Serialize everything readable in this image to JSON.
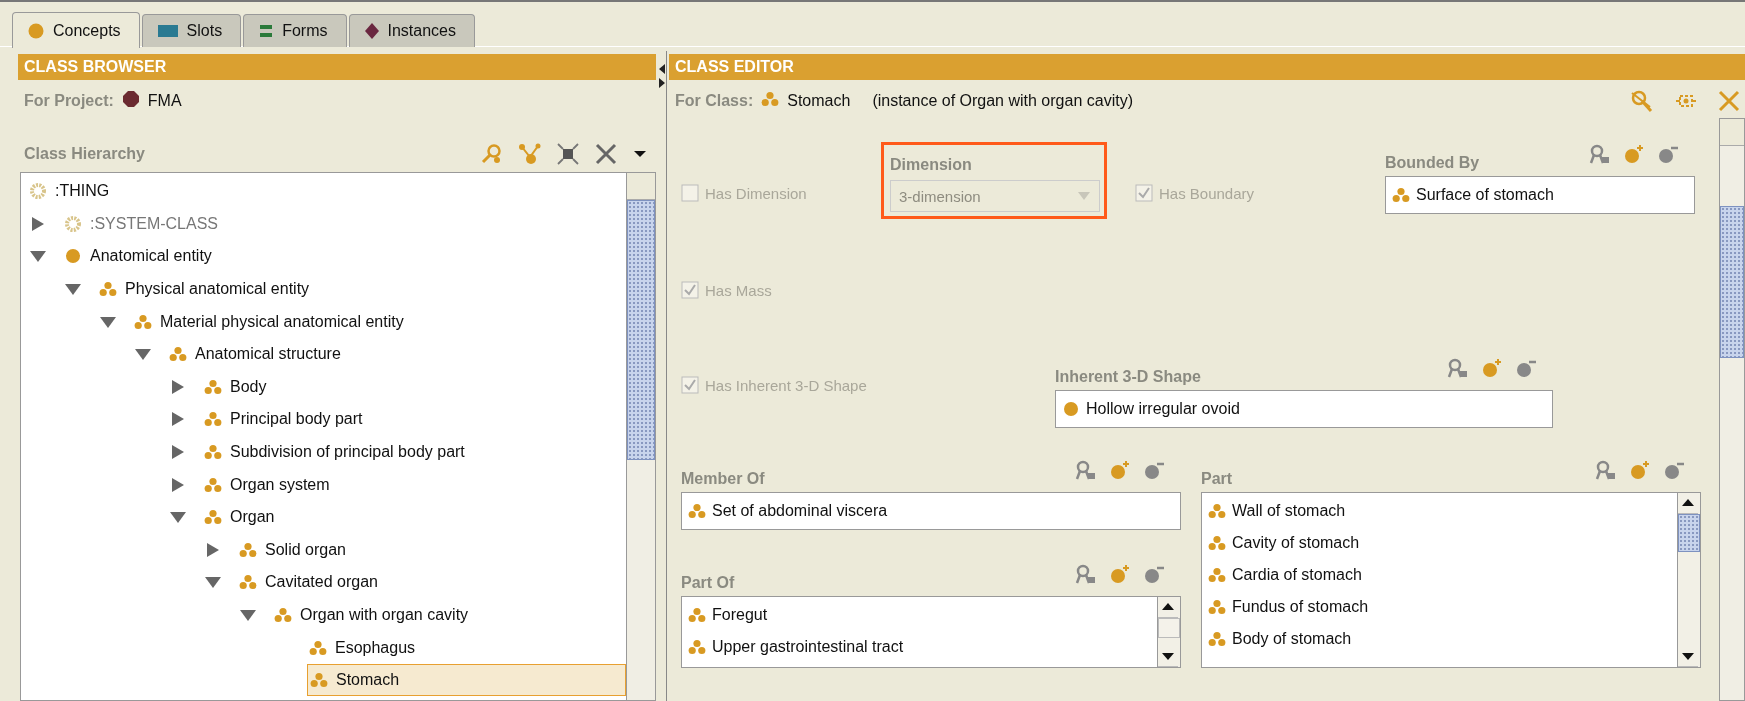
{
  "tabs": [
    {
      "label": "Concepts",
      "kind": "concept",
      "selected": true
    },
    {
      "label": "Slots",
      "kind": "slot",
      "selected": false
    },
    {
      "label": "Forms",
      "kind": "form",
      "selected": false
    },
    {
      "label": "Instances",
      "kind": "instance",
      "selected": false
    }
  ],
  "class_browser": {
    "title": "CLASS BROWSER",
    "project_label": "For Project:",
    "project": "FMA",
    "hierarchy_label": "Class Hierarchy",
    "tree": [
      {
        "label": ":THING",
        "kind": "system",
        "children": [
          {
            "label": ":SYSTEM-CLASS",
            "kind": "system",
            "expanded": false,
            "selected": false
          },
          {
            "label": "Anatomical entity",
            "kind": "instance",
            "expanded": true,
            "selected": false,
            "children": [
              {
                "label": "Physical anatomical entity",
                "kind": "class",
                "expanded": true,
                "selected": false,
                "children": [
                  {
                    "label": "Material physical anatomical entity",
                    "kind": "class",
                    "expanded": true,
                    "selected": false,
                    "children": [
                      {
                        "label": "Anatomical structure",
                        "kind": "class",
                        "expanded": true,
                        "selected": false,
                        "children": [
                          {
                            "label": "Body",
                            "kind": "class",
                            "expanded": false,
                            "selected": false
                          },
                          {
                            "label": "Principal body part",
                            "kind": "class",
                            "expanded": false,
                            "selected": false
                          },
                          {
                            "label": "Subdivision of principal body part",
                            "kind": "class",
                            "expanded": false,
                            "selected": false
                          },
                          {
                            "label": "Organ system",
                            "kind": "class",
                            "expanded": false,
                            "selected": false
                          },
                          {
                            "label": "Organ",
                            "kind": "class",
                            "expanded": true,
                            "selected": false,
                            "children": [
                              {
                                "label": "Solid organ",
                                "kind": "class",
                                "expanded": false,
                                "selected": false
                              },
                              {
                                "label": "Cavitated organ",
                                "kind": "class",
                                "expanded": true,
                                "selected": false,
                                "children": [
                                  {
                                    "label": "Organ with organ cavity",
                                    "kind": "class",
                                    "expanded": true,
                                    "selected": false,
                                    "children": [
                                      {
                                        "label": "Esophagus",
                                        "kind": "class",
                                        "selected": false
                                      },
                                      {
                                        "label": "Stomach",
                                        "kind": "class",
                                        "selected": true
                                      }
                                    ]
                                  }
                                ]
                              }
                            ]
                          }
                        ]
                      }
                    ]
                  }
                ]
              }
            ]
          }
        ],
        "selected": false
      }
    ]
  },
  "class_editor": {
    "title": "CLASS EDITOR",
    "class_label": "For Class:",
    "class_name": "Stomach",
    "instance_of": "(instance of Organ with organ cavity)",
    "rows": [
      [
        {
          "kind": "checkbox",
          "label": "Has Dimension",
          "checked": false,
          "disabled": true
        },
        {
          "kind": "combo",
          "label": "Dimension",
          "value": "3-dimension",
          "disabled": true,
          "highlighted": true
        },
        {
          "kind": "checkbox",
          "label": "Has Boundary",
          "checked": true,
          "disabled": true
        },
        {
          "kind": "list",
          "label": "Bounded By",
          "items": [
            {
              "label": "Surface of stomach",
              "kind": "class"
            }
          ]
        }
      ],
      [
        {
          "kind": "checkbox",
          "label": "Has Mass",
          "checked": true,
          "disabled": true
        }
      ],
      [
        {
          "kind": "checkbox",
          "label": "Has Inherent 3-D Shape",
          "checked": true,
          "disabled": true
        },
        {
          "kind": "list",
          "label": "Inherent 3-D Shape",
          "items": [
            {
              "label": "Hollow irregular ovoid",
              "kind": "instance"
            }
          ]
        }
      ],
      [
        {
          "kind": "list",
          "label": "Member Of",
          "items": [
            {
              "label": "Set of abdominal viscera",
              "kind": "class"
            }
          ]
        },
        {
          "kind": "list",
          "label": "Part",
          "scroll": true,
          "items": [
            {
              "label": "Wall of stomach",
              "kind": "class"
            },
            {
              "label": "Cavity of stomach",
              "kind": "class"
            },
            {
              "label": "Cardia of stomach",
              "kind": "class"
            },
            {
              "label": "Fundus of stomach",
              "kind": "class"
            },
            {
              "label": "Body of stomach",
              "kind": "class"
            }
          ]
        }
      ],
      [
        {
          "kind": "list",
          "label": "Part Of",
          "scroll": true,
          "items": [
            {
              "label": "Foregut",
              "kind": "class"
            },
            {
              "label": "Upper gastrointestinal tract",
              "kind": "class"
            }
          ]
        }
      ]
    ]
  }
}
